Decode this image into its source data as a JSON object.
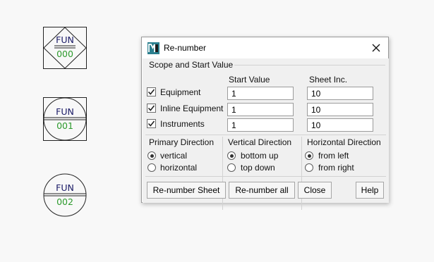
{
  "canvas": {
    "symbols": [
      {
        "name": "FUN",
        "number": "000"
      },
      {
        "name": "FUN",
        "number": "001"
      },
      {
        "name": "FUN",
        "number": "002"
      }
    ]
  },
  "dialog": {
    "title": "Re-number",
    "scope": {
      "label": "Scope and Start Value",
      "start_value_header": "Start Value",
      "sheet_inc_header": "Sheet Inc.",
      "rows": [
        {
          "label": "Equipment",
          "checked": true,
          "start_value": "1",
          "sheet_inc": "10"
        },
        {
          "label": "Inline Equipment",
          "checked": true,
          "start_value": "1",
          "sheet_inc": "10"
        },
        {
          "label": "Instruments",
          "checked": true,
          "start_value": "1",
          "sheet_inc": "10"
        }
      ]
    },
    "primary_direction": {
      "label": "Primary Direction",
      "options": [
        {
          "label": "vertical",
          "selected": true
        },
        {
          "label": "horizontal",
          "selected": false
        }
      ]
    },
    "vertical_direction": {
      "label": "Vertical Direction",
      "options": [
        {
          "label": "bottom up",
          "selected": true
        },
        {
          "label": "top down",
          "selected": false
        }
      ]
    },
    "horizontal_direction": {
      "label": "Horizontal Direction",
      "options": [
        {
          "label": "from left",
          "selected": true
        },
        {
          "label": "from right",
          "selected": false
        }
      ]
    },
    "buttons": {
      "renumber_sheet": "Re-number Sheet",
      "renumber_all": "Re-number all",
      "close": "Close",
      "help": "Help"
    }
  },
  "colors": {
    "symbol_name": "#1a1a66",
    "symbol_number": "#2c9a2c",
    "app_icon_bg": "#2a7f8e"
  },
  "icons": {
    "app": "app-logo-icon",
    "close": "close-icon",
    "check": "check-icon"
  }
}
